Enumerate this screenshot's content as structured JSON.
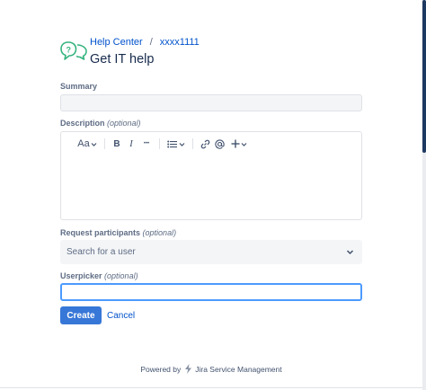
{
  "breadcrumb": {
    "help_center": "Help Center",
    "separator": "/",
    "project": "xxxx1111"
  },
  "page_title": "Get IT help",
  "fields": {
    "summary": {
      "label": "Summary"
    },
    "description": {
      "label": "Description",
      "optional": "(optional)"
    },
    "participants": {
      "label": "Request participants",
      "optional": "(optional)",
      "placeholder": "Search for a user"
    },
    "userpicker": {
      "label": "Userpicker",
      "optional": "(optional)"
    }
  },
  "editor_toolbar": {
    "text_style": "Aa",
    "bold": "B",
    "italic": "I",
    "more": "•••"
  },
  "actions": {
    "create": "Create",
    "cancel": "Cancel"
  },
  "footer": {
    "powered_by": "Powered by",
    "product": "Jira Service Management"
  },
  "colors": {
    "primary": "#0052cc",
    "focus": "#4c9aff",
    "text": "#172b4d",
    "logo": "#36b37e"
  }
}
